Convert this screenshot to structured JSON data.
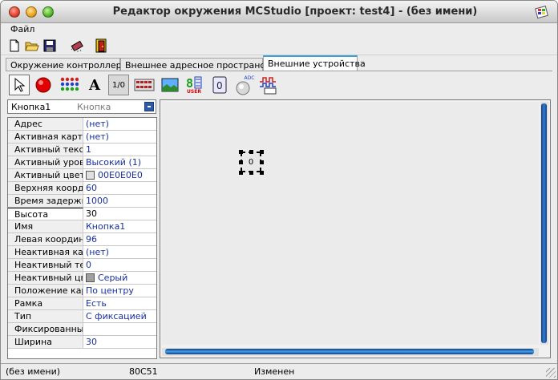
{
  "window": {
    "title": "Редактор окружения MCStudio [проект: test4] - (без имени)"
  },
  "menu": {
    "file": "Файл"
  },
  "toolbar": {
    "icons": [
      "new-file-icon",
      "open-folder-icon",
      "save-disk-icon",
      "chip-icon",
      "exit-door-icon"
    ]
  },
  "tabs": [
    {
      "label": "Окружение контроллера",
      "active": false
    },
    {
      "label": "Внешнее адресное пространство",
      "active": false
    },
    {
      "label": "Внешние устройства",
      "active": true
    }
  ],
  "tools": {
    "icons": [
      "pointer-icon",
      "led-icon",
      "matrix-icon",
      "text-icon",
      "io-icon",
      "keyboard-icon",
      "image-icon",
      "user-indicator-icon",
      "encoder-icon",
      "adc-icon",
      "signal-icon"
    ],
    "io_label": "1/0",
    "text_label": "A",
    "user_label": "USER",
    "adc_label": "ADC"
  },
  "object_selector": {
    "name": "Кнопка1",
    "type": "Кнопка"
  },
  "properties": [
    {
      "name": "Адрес",
      "value": "(нет)"
    },
    {
      "name": "Активная картинка",
      "value": "(нет)"
    },
    {
      "name": "Активный текст",
      "value": "1"
    },
    {
      "name": "Активный уровень",
      "value": "Высокий (1)"
    },
    {
      "name": "Активный цвет",
      "value": "00E0E0E0",
      "swatch": "#e0e0e0"
    },
    {
      "name": "Верхняя координата",
      "value": "60"
    },
    {
      "name": "Время задержки",
      "value": "1000"
    },
    {
      "name": "Высота",
      "value": "30",
      "current": true
    },
    {
      "name": "Имя",
      "value": "Кнопка1"
    },
    {
      "name": "Левая координата",
      "value": "96"
    },
    {
      "name": "Неактивная картинка",
      "value": "(нет)"
    },
    {
      "name": "Неактивный текст",
      "value": "0"
    },
    {
      "name": "Неактивный цвет",
      "value": "Серый",
      "swatch": "#a0a0a0"
    },
    {
      "name": "Положение картинки",
      "value": "По центру"
    },
    {
      "name": "Рамка",
      "value": "Есть"
    },
    {
      "name": "Тип",
      "value": "С фиксацией"
    },
    {
      "name": "Фиксированный",
      "value": ""
    },
    {
      "name": "Ширина",
      "value": "30"
    }
  ],
  "canvas": {
    "button_text": "0"
  },
  "status": {
    "file": "(без имени)",
    "controller": "80C51",
    "state": "Изменен"
  },
  "colors": {
    "accent": "#3aa0d8",
    "scroll": "#2f7fd8",
    "prop_value": "#1a2fa0"
  }
}
